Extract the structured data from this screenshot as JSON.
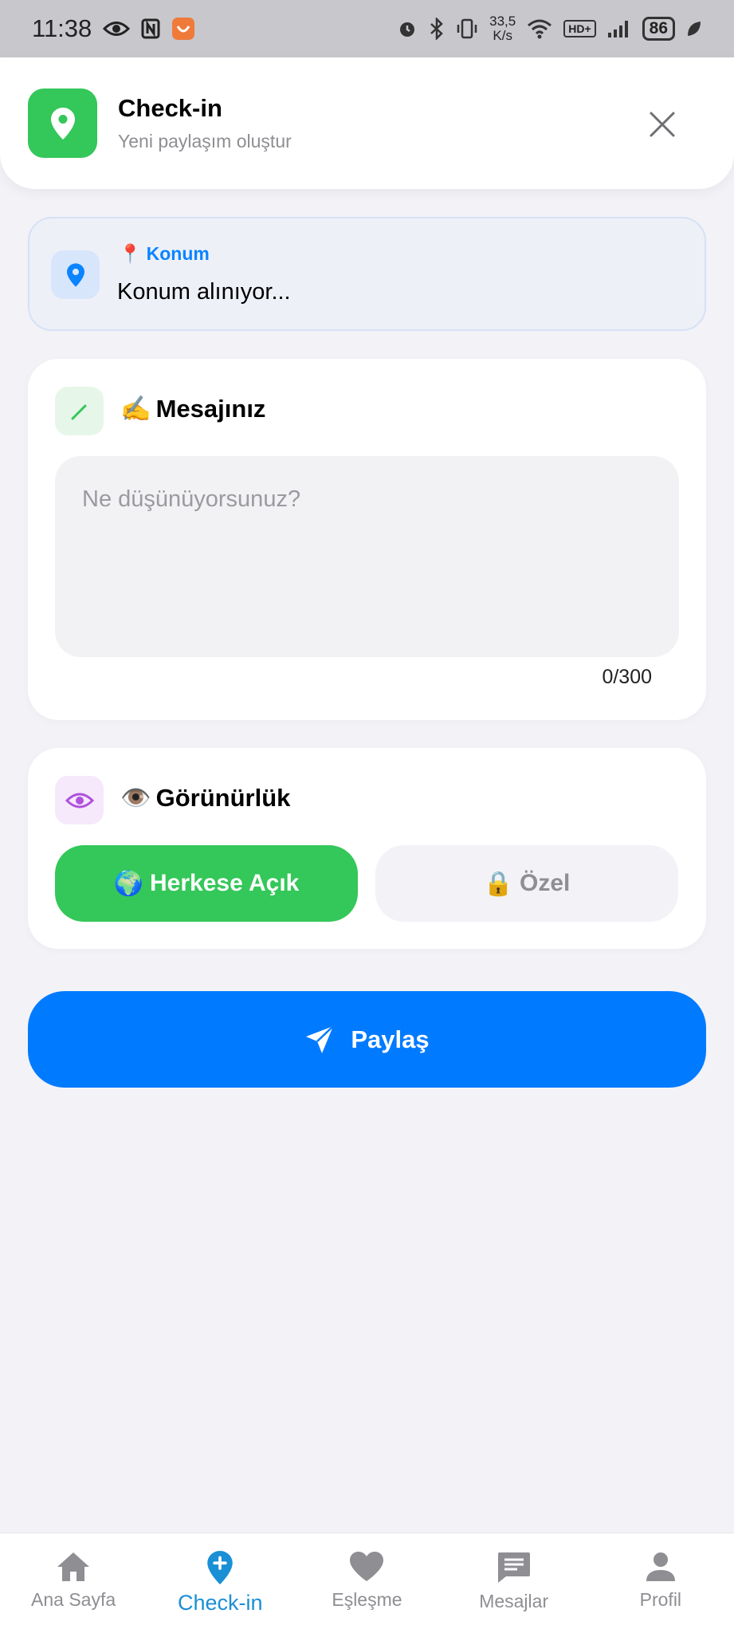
{
  "status_bar": {
    "time": "11:38",
    "speed_value": "33,5",
    "speed_unit": "K/s",
    "hd_label": "HD+",
    "battery": "86"
  },
  "header": {
    "title": "Check-in",
    "subtitle": "Yeni paylaşım oluştur",
    "accent": "#34c759"
  },
  "location": {
    "label_emoji": "📍",
    "label": "Konum",
    "value": "Konum alınıyor..."
  },
  "message": {
    "title_emoji": "✍️",
    "title": "Mesajınız",
    "placeholder": "Ne düşünüyorsunuz?",
    "value": "",
    "char_count": "0/300"
  },
  "visibility": {
    "title_emoji": "👁️",
    "title": "Görünürlük",
    "options": [
      {
        "emoji": "🌍",
        "label": "Herkese Açık",
        "selected": true
      },
      {
        "emoji": "🔒",
        "label": "Özel",
        "selected": false
      }
    ]
  },
  "share_button": {
    "label": "Paylaş",
    "color": "#007aff"
  },
  "tabbar": {
    "items": [
      {
        "label": "Ana Sayfa",
        "icon": "home-icon",
        "active": false
      },
      {
        "label": "Check-in",
        "icon": "location-plus-icon",
        "active": true
      },
      {
        "label": "Eşleşme",
        "icon": "heart-icon",
        "active": false
      },
      {
        "label": "Mesajlar",
        "icon": "chat-icon",
        "active": false
      },
      {
        "label": "Profil",
        "icon": "person-icon",
        "active": false
      }
    ]
  }
}
